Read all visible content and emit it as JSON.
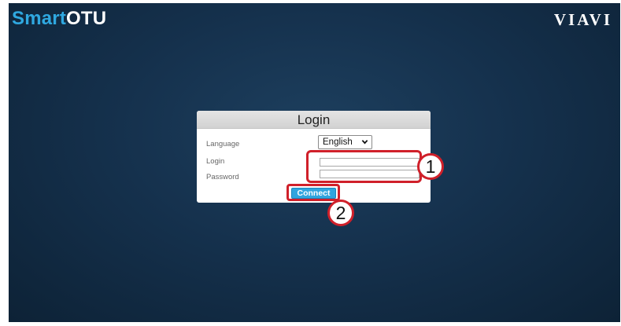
{
  "app": {
    "brand_prefix": "Smart",
    "brand_suffix": "OTU",
    "vendor_logo": "VIAVI"
  },
  "login": {
    "title": "Login",
    "language_label": "Language",
    "language_value": "English",
    "login_label": "Login",
    "login_value": "",
    "password_label": "Password",
    "password_value": "",
    "connect_label": "Connect"
  },
  "callouts": {
    "first": "1",
    "second": "2"
  },
  "icons": {
    "language_dropdown": "chevron-down-icon"
  },
  "colors": {
    "background": "#15314d",
    "brand_accent": "#2fa8e0",
    "connect_button": "#30a5de",
    "callout": "#d0202a",
    "panel_header": "#d9d9d9"
  }
}
